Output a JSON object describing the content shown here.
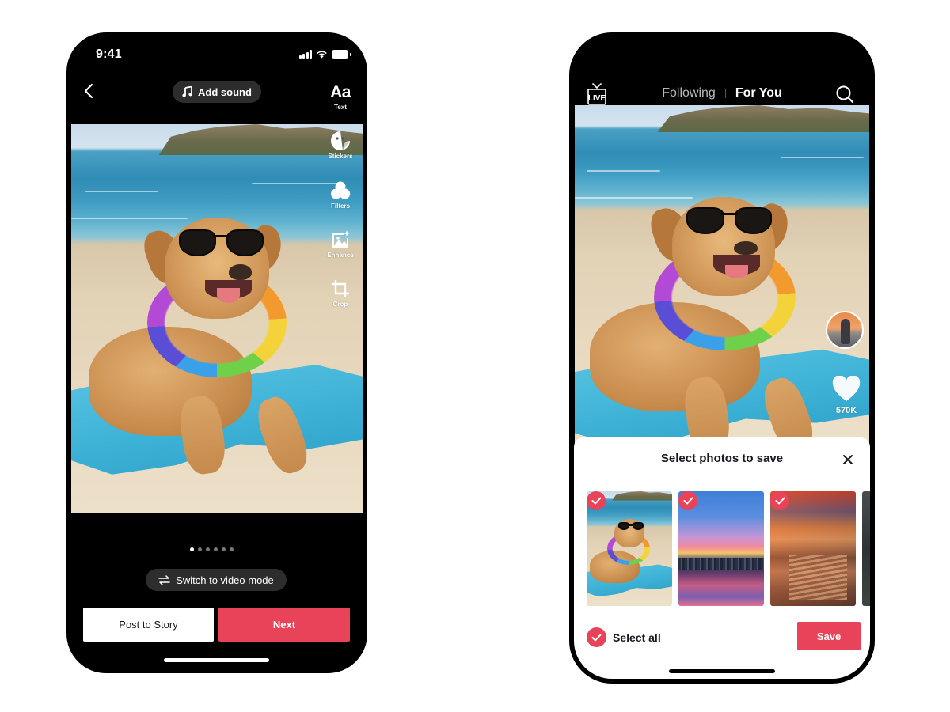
{
  "left_phone": {
    "status_bar": {
      "time": "9:41",
      "icons": [
        "signal-icon",
        "wifi-icon",
        "battery-icon"
      ]
    },
    "top_bar": {
      "back_icon": "chevron-left-icon",
      "add_sound_label": "Add sound",
      "add_sound_icon": "music-note-icon"
    },
    "tools": [
      {
        "id": "text",
        "glyph": "Aa",
        "label": "Text"
      },
      {
        "id": "stickers",
        "icon": "sticker-icon",
        "label": "Stickers"
      },
      {
        "id": "filters",
        "icon": "filters-icon",
        "label": "Filters"
      },
      {
        "id": "enhance",
        "icon": "enhance-icon",
        "label": "Enhance"
      },
      {
        "id": "crop",
        "icon": "crop-icon",
        "label": "Crop"
      }
    ],
    "photo": {
      "description": "Dog wearing sunglasses and a rainbow flower lei lying on a blue towel on a beach"
    },
    "pager": {
      "total": 6,
      "current": 1
    },
    "switch_mode_label": "Switch to video mode",
    "switch_mode_icon": "swap-arrows-icon",
    "buttons": {
      "post_to_story": "Post to Story",
      "next": "Next"
    }
  },
  "right_phone": {
    "header": {
      "live_icon": "live-tv-icon",
      "live_text": "LIVE",
      "tabs": [
        {
          "label": "Following",
          "active": false
        },
        {
          "label": "For You",
          "active": true
        }
      ],
      "search_icon": "search-icon"
    },
    "feed": {
      "photo": {
        "description": "Dog wearing sunglasses and a rainbow flower lei lying on a blue towel on a beach"
      },
      "avatar": {
        "description": "Person standing at the beach at sunset"
      },
      "like_count": "570K"
    },
    "save_sheet": {
      "title": "Select photos to save",
      "close_icon": "close-icon",
      "thumbnails": [
        {
          "description": "Dog on beach with sunglasses",
          "selected": true
        },
        {
          "description": "City skyline at sunset over colorful market",
          "selected": true
        },
        {
          "description": "Night market food stall with skewers",
          "selected": true
        },
        {
          "description": "Dark landscape photo (partially visible)",
          "selected": false
        }
      ],
      "select_all_label": "Select all",
      "select_all_checked": true,
      "save_label": "Save"
    }
  },
  "colors": {
    "accent": "#E9435A",
    "phone_frame": "#000000",
    "pill_bg": "#2D2D2D",
    "text_primary": "#161823",
    "inactive_tab": "#B7B7B7"
  }
}
